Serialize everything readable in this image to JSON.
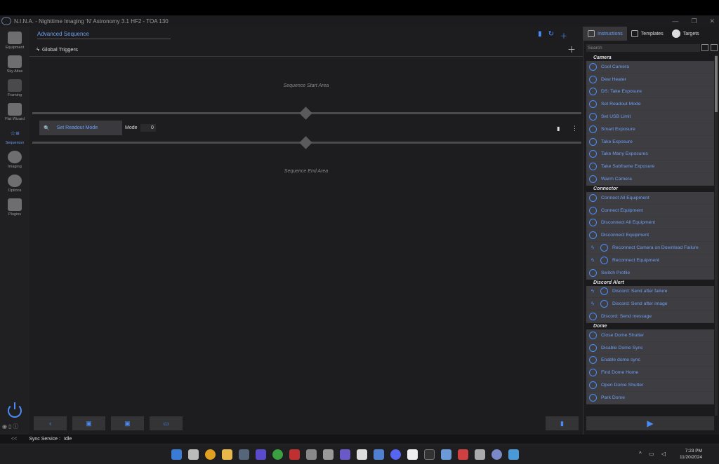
{
  "window": {
    "title": "N.I.N.A. - Nighttime Imaging 'N' Astronomy 3.1 HF2   -   TOA 130",
    "min": "—",
    "max": "❐",
    "close": "✕"
  },
  "nav": [
    {
      "label": "Equipment",
      "icon": "telescope-icon"
    },
    {
      "label": "Sky Atlas",
      "icon": "map-icon"
    },
    {
      "label": "Framing",
      "icon": "framing-icon"
    },
    {
      "label": "Flat Wizard",
      "icon": "flat-panel-icon"
    },
    {
      "label": "Sequencer",
      "icon": "sequencer-icon",
      "active": true
    },
    {
      "label": "Imaging",
      "icon": "imaging-icon"
    },
    {
      "label": "Options",
      "icon": "gear-icon"
    },
    {
      "label": "Plugins",
      "icon": "puzzle-icon"
    }
  ],
  "sequence": {
    "title": "Advanced Sequence",
    "global_triggers": "Global Triggers",
    "start_area": "Sequence Start Area",
    "end_area": "Sequence End Area",
    "instruction": {
      "label": "Set Readout Mode",
      "mode_label": "Mode",
      "mode_value": "0"
    }
  },
  "tabs": [
    {
      "label": "Instructions"
    },
    {
      "label": "Templates"
    },
    {
      "label": "Targets"
    }
  ],
  "search": {
    "placeholder": "Search"
  },
  "library": [
    {
      "category": "Camera",
      "items": [
        "Cool Camera",
        "Dew Heater",
        "DS: Take Exposure",
        "Set Readout Mode",
        "Set USB Limit",
        "Smart Exposure",
        "Take Exposure",
        "Take Many Exposures",
        "Take Subframe Exposure",
        "Warm Camera"
      ]
    },
    {
      "category": "Connector",
      "items": [
        "Connect All Equipment",
        "Connect Equipment",
        "Disconnect All Equipment",
        "Disconnect Equipment",
        "Reconnect Camera on Download Failure",
        "Reconnect Equipment",
        "Switch Profile"
      ]
    },
    {
      "category": "Discord Alert",
      "items": [
        "Discord: Send after failure",
        "Discord: Send after image",
        "Discord: Send message"
      ]
    },
    {
      "category": "Dome",
      "items": [
        "Close Dome Shutter",
        "Disable Dome Sync",
        "Enable dome sync",
        "Find Dome Home",
        "Open Dome Shutter",
        "Park Dome"
      ]
    }
  ],
  "status": {
    "chevron": "<<",
    "label": "Sync Service :",
    "value": "Idle"
  },
  "clock": {
    "time": "7:23 PM",
    "date": "11/20/2024"
  },
  "colors": {
    "accent": "#4a8cf7",
    "panel": "#1d1d20",
    "item_bg": "#3e3e42"
  }
}
